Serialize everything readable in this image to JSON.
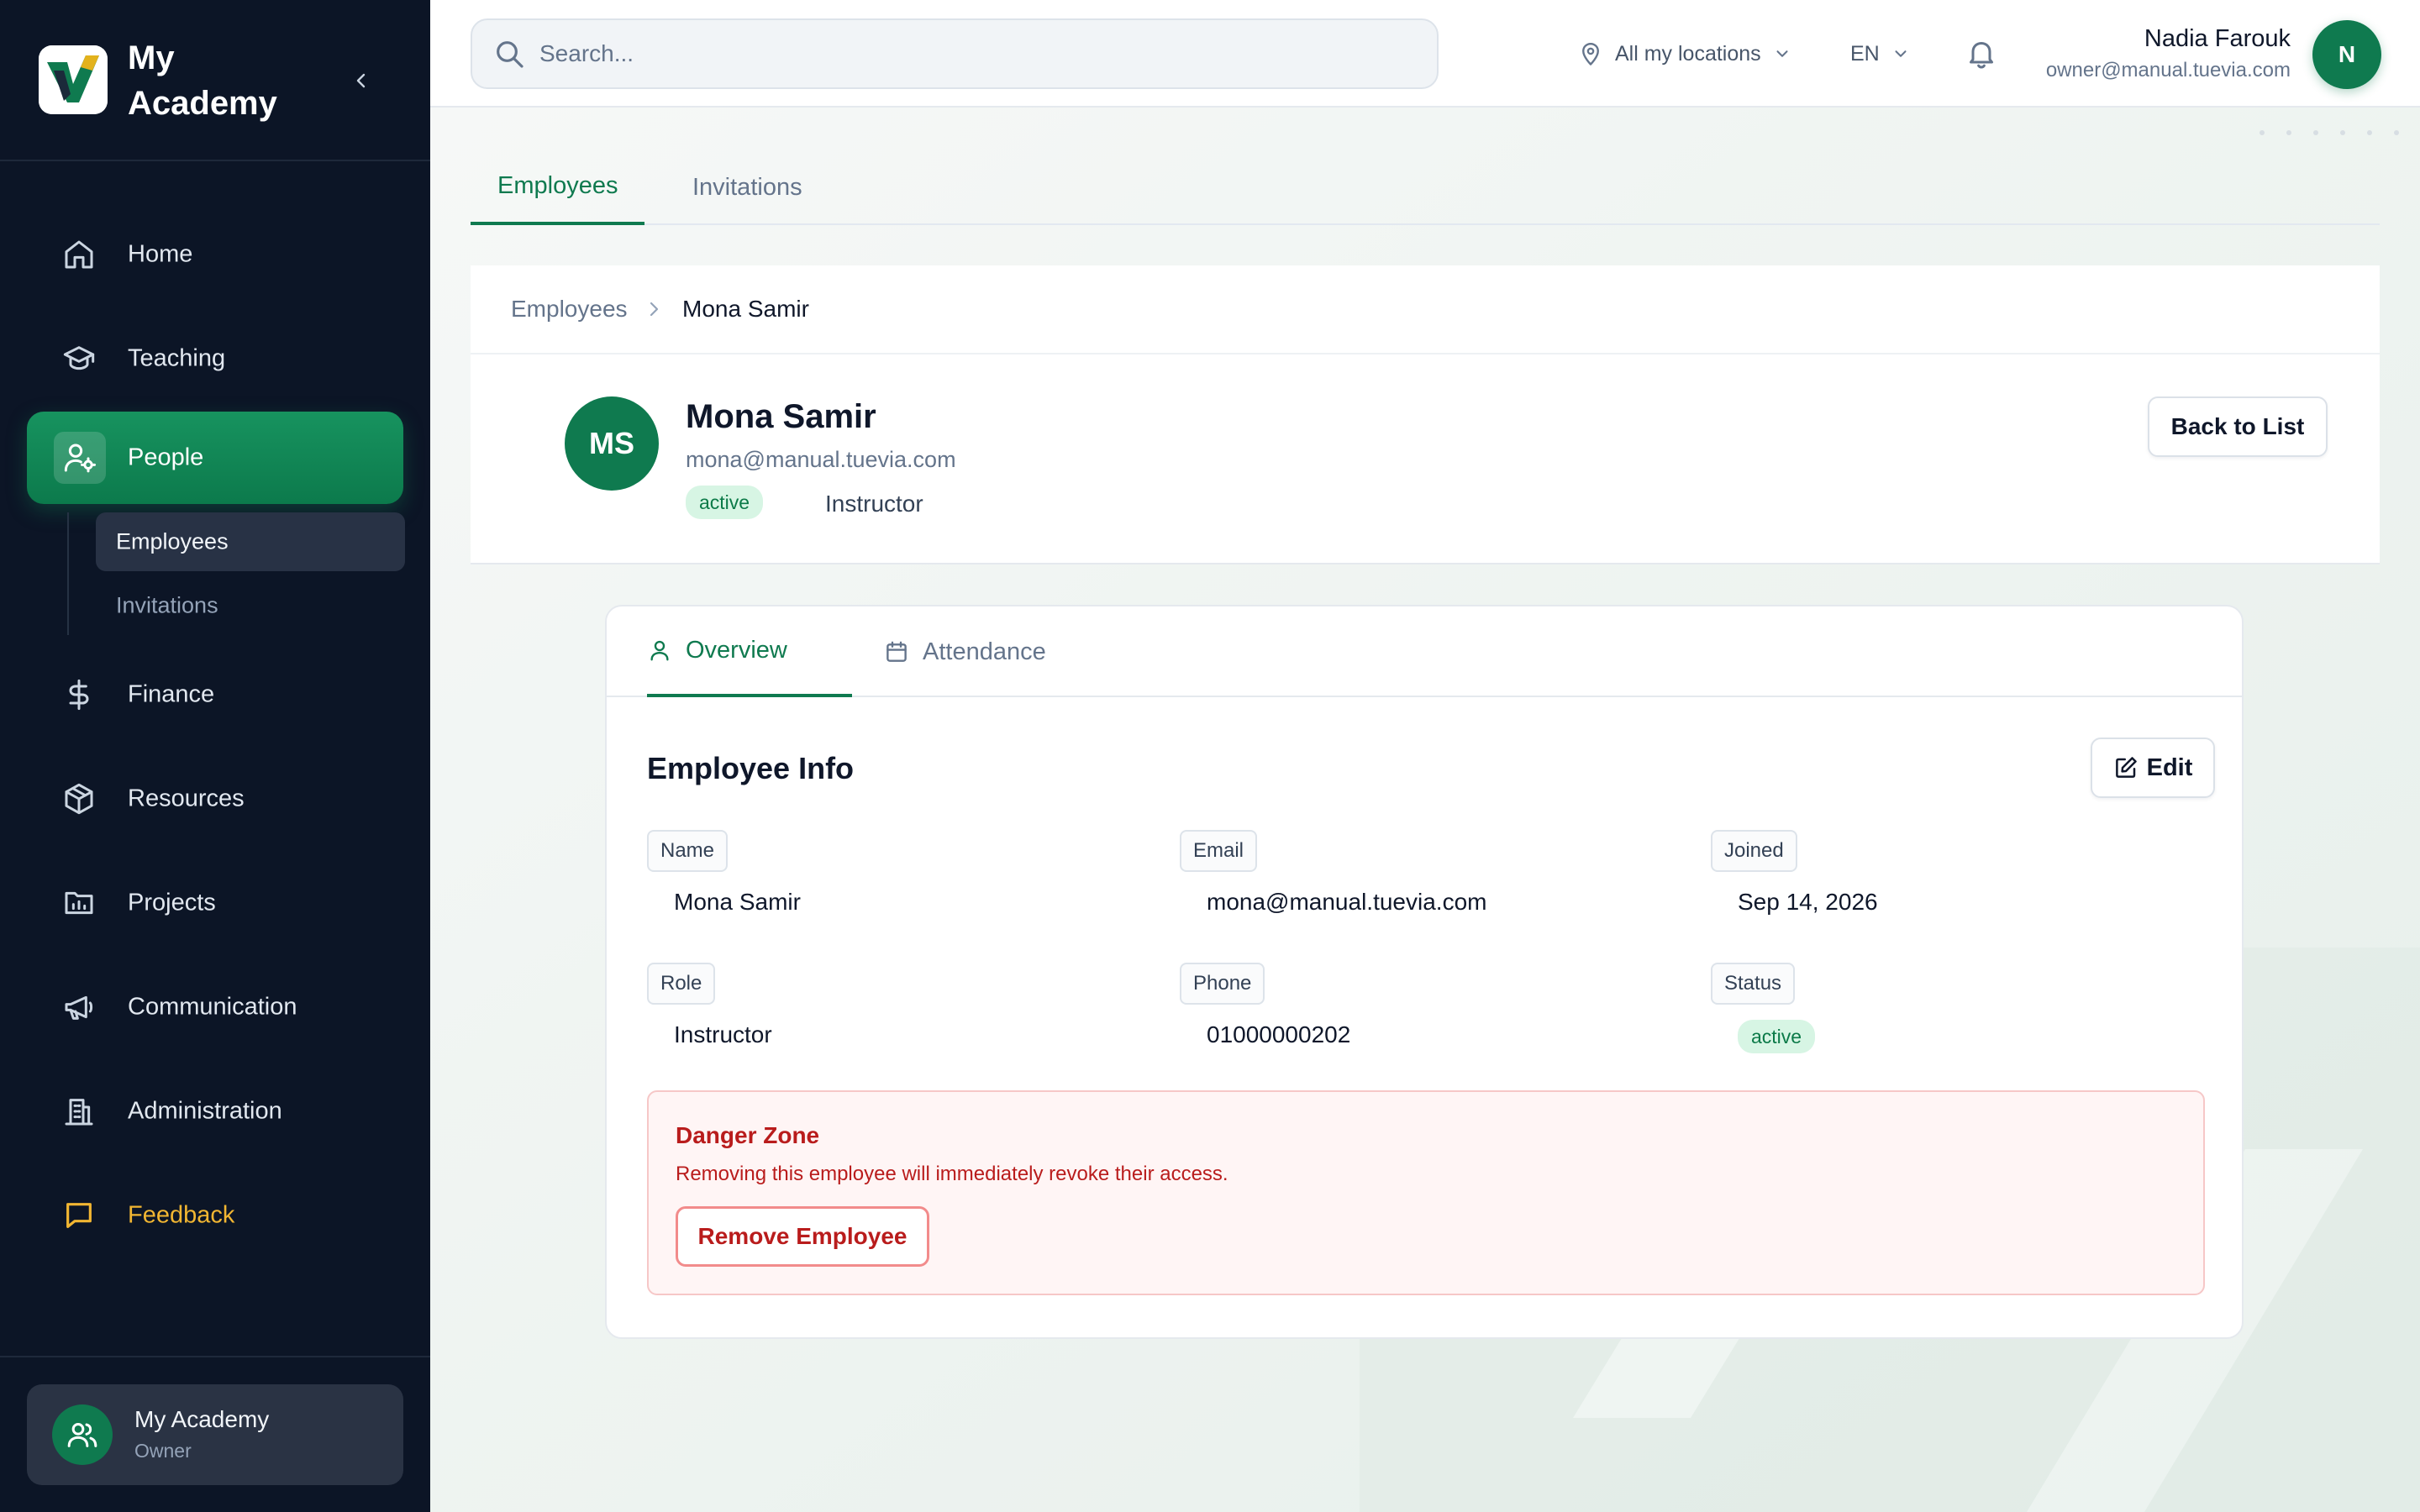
{
  "app": {
    "brand_name": "My Academy"
  },
  "sidebar": {
    "items": [
      {
        "label": "Home",
        "icon": "home-icon"
      },
      {
        "label": "Teaching",
        "icon": "graduation-cap-icon"
      },
      {
        "label": "People",
        "icon": "user-cog-icon",
        "active": true
      },
      {
        "label": "Finance",
        "icon": "dollar-icon"
      },
      {
        "label": "Resources",
        "icon": "package-icon"
      },
      {
        "label": "Projects",
        "icon": "folder-chart-icon"
      },
      {
        "label": "Communication",
        "icon": "megaphone-icon"
      },
      {
        "label": "Administration",
        "icon": "building-icon"
      },
      {
        "label": "Feedback",
        "icon": "message-square-icon"
      }
    ],
    "subitems": [
      {
        "label": "Employees",
        "active": true
      },
      {
        "label": "Invitations"
      }
    ],
    "account": {
      "name": "My Academy",
      "role": "Owner"
    }
  },
  "topbar": {
    "search_placeholder": "Search...",
    "location": "All my locations",
    "language": "EN",
    "user_name": "Nadia Farouk",
    "user_email": "owner@manual.tuevia.com",
    "user_initial": "N"
  },
  "tabs": [
    "Employees",
    "Invitations"
  ],
  "breadcrumb": {
    "parent": "Employees",
    "current": "Mona Samir"
  },
  "employee": {
    "initials": "MS",
    "name": "Mona Samir",
    "email": "mona@manual.tuevia.com",
    "status": "active",
    "role": "Instructor",
    "back_label": "Back to List"
  },
  "detail_tabs": [
    {
      "label": "Overview",
      "icon": "user-icon"
    },
    {
      "label": "Attendance",
      "icon": "calendar-icon"
    }
  ],
  "info": {
    "title": "Employee Info",
    "edit_label": "Edit",
    "fields": [
      {
        "label": "Name",
        "value": "Mona Samir"
      },
      {
        "label": "Email",
        "value": "mona@manual.tuevia.com"
      },
      {
        "label": "Joined",
        "value": "Sep 14, 2026"
      },
      {
        "label": "Role",
        "value": "Instructor"
      },
      {
        "label": "Phone",
        "value": "01000000202"
      },
      {
        "label": "Status",
        "value": "active"
      }
    ]
  },
  "danger_zone": {
    "title": "Danger Zone",
    "text": "Removing this employee will immediately revoke their access.",
    "button": "Remove Employee"
  },
  "colors": {
    "brand_green": "#0f7a4f",
    "sidebar_bg": "#0c1526",
    "feedback_yellow": "#f2b632",
    "danger_red": "#b91c1c"
  }
}
